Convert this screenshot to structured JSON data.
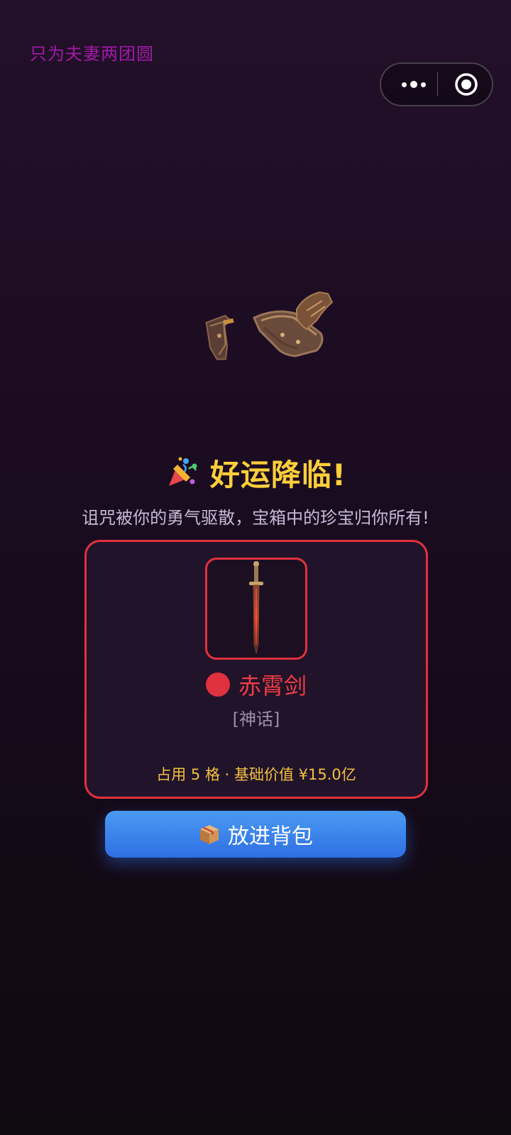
{
  "watermark": "只为夫妻两团圆",
  "reward": {
    "title": "好运降临!",
    "subtitle": "诅咒被你的勇气驱散，宝箱中的珍宝归你所有!",
    "item": {
      "name": "赤霄剑",
      "rarity": "[神话]",
      "stats": "占用 5 格 · 基础价值 ¥15.0亿",
      "rarity_color": "#e0323e"
    }
  },
  "actions": {
    "stash_label": "放进背包"
  },
  "icons": {
    "title": "party-popper-icon",
    "item": "red-sword-icon",
    "button": "package-box-icon",
    "menu": "more-dots-icon",
    "close": "target-close-icon"
  },
  "colors": {
    "accent_gold": "#ffcf3a",
    "mythic_red": "#e0323e",
    "button_blue": "#3a82ee"
  }
}
